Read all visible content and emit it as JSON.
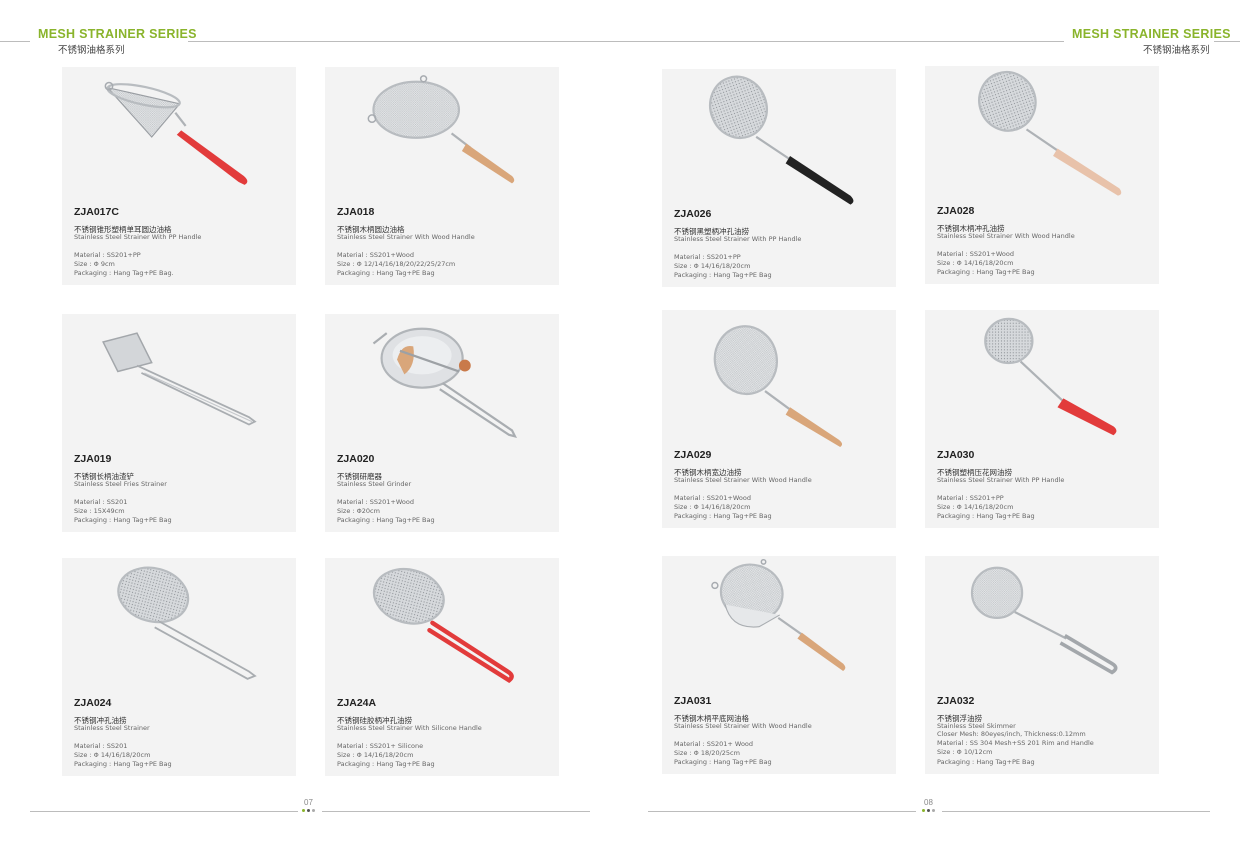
{
  "header": {
    "left_title": "MESH STRAINER SERIES",
    "left_subtitle": "不锈钢油格系列",
    "right_title": "MESH STRAINER SERIES",
    "right_subtitle": "不锈钢油格系列"
  },
  "colors": {
    "accent_green": "#8ab42c",
    "card_bg": "#f3f3f3",
    "handle_red": "#e23b3b",
    "handle_wood": "#d9a67a",
    "handle_black": "#222222",
    "steel": "#c9ccd0"
  },
  "products": [
    {
      "code": "ZJA017C",
      "cn": "不锈钢锥形塑柄单耳圆边油格",
      "en": "Stainless Steel Strainer With PP Handle",
      "material": "Material : SS201+PP",
      "size": "Size : Φ 9cm",
      "packaging": "Packaging :  Hang Tag+PE Bag.",
      "icon": "cone-strainer-red-handle-icon"
    },
    {
      "code": "ZJA018",
      "cn": "不锈钢木柄圆边油格",
      "en": "Stainless Steel Strainer With Wood Handle",
      "material": "Material : SS201+Wood",
      "size": "Size : Φ 12/14/16/18/20/22/25/27cm",
      "packaging": "Packaging :  Hang Tag+PE Bag",
      "icon": "mesh-strainer-wood-handle-icon"
    },
    {
      "code": "ZJA026",
      "cn": "不锈钢黑塑柄冲孔油捞",
      "en": "Stainless Steel Strainer With PP Handle",
      "material": "Material : SS201+PP",
      "size": "Size : Φ 14/16/18/20cm",
      "packaging": "Packaging :  Hang Tag+PE Bag",
      "icon": "perforated-ladle-black-handle-icon"
    },
    {
      "code": "ZJA028",
      "cn": "不锈钢木柄冲孔油捞",
      "en": "Stainless Steel Strainer With Wood Handle",
      "material": "Material : SS201+Wood",
      "size": "Size : Φ 14/16/18/20cm",
      "packaging": "Packaging :  Hang Tag+PE Bag",
      "icon": "perforated-ladle-wood-handle-icon"
    },
    {
      "code": "ZJA019",
      "cn": "不锈钢长柄油渣铲",
      "en": "Stainless Steel Fries Strainer",
      "material": "Material : SS201",
      "size": "Size : 15X49cm",
      "packaging": "Packaging :  Hang Tag+PE Bag",
      "icon": "fries-shovel-icon"
    },
    {
      "code": "ZJA020",
      "cn": "不锈钢研磨器",
      "en": "Stainless Steel Grinder",
      "material": "Material : SS201+Wood",
      "size": "Size : Φ20cm",
      "packaging": "Packaging :  Hang Tag+PE Bag",
      "icon": "food-mill-grinder-icon"
    },
    {
      "code": "ZJA029",
      "cn": "不锈钢木柄宽边油捞",
      "en": "Stainless Steel Strainer With Wood Handle",
      "material": "Material : SS201+Wood",
      "size": "Size : Φ 14/16/18/20cm",
      "packaging": "Packaging :  Hang Tag+PE Bag",
      "icon": "mesh-skimmer-wood-handle-icon"
    },
    {
      "code": "ZJA030",
      "cn": "不锈钢塑柄压花网油捞",
      "en": "Stainless Steel Strainer With PP Handle",
      "material": "Material : SS201+PP",
      "size": "Size : Φ 14/16/18/20cm",
      "packaging": "Packaging :  Hang Tag+PE Bag",
      "icon": "mesh-skimmer-red-handle-icon"
    },
    {
      "code": "ZJA024",
      "cn": "不锈钢冲孔油捞",
      "en": "Stainless Steel Strainer",
      "material": "Material : SS201",
      "size": "Size : Φ 14/16/18/20cm",
      "packaging": "Packaging :  Hang Tag+PE Bag",
      "icon": "perforated-ladle-wire-handle-icon"
    },
    {
      "code": "ZJA24A",
      "cn": "不锈钢硅胶柄冲孔油捞",
      "en": "Stainless Steel Strainer With Silicone Handle",
      "material": "Material : SS201+ Silicone",
      "size": "Size : Φ 14/16/18/20cm",
      "packaging": "Packaging :  Hang Tag+PE Bag",
      "icon": "perforated-ladle-silicone-handle-icon"
    },
    {
      "code": "ZJA031",
      "cn": "不锈钢木柄平底网油格",
      "en": "Stainless Steel Strainer With Wood Handle",
      "material": "Material : SS201+ Wood",
      "size": "Size : Φ 18/20/25cm",
      "packaging": "Packaging :  Hang Tag+PE Bag",
      "icon": "flat-bottom-strainer-wood-handle-icon"
    },
    {
      "code": "ZJA032",
      "cn": "不锈钢浮油捞",
      "en": "Stainless Steel Skimmer",
      "closer_mesh": "Closer Mesh: 80eyes/inch, Thickness:0.12mm",
      "material": "Material : SS 304 Mesh+SS 201 Rim and Handle",
      "size": "Size : Φ 10/12cm",
      "packaging": "Packaging :  Hang Tag+PE Bag",
      "icon": "oil-skimmer-icon"
    }
  ],
  "footer": {
    "left_page": "07",
    "right_page": "08"
  }
}
